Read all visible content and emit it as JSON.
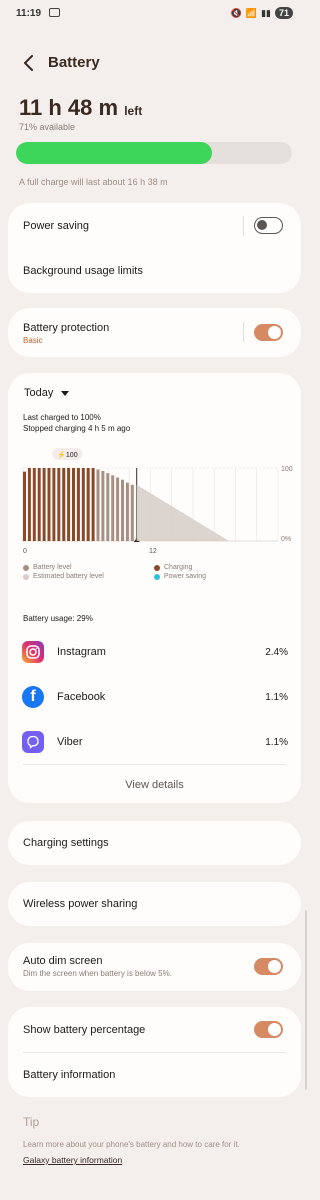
{
  "status": {
    "time": "11:19",
    "battery": "71"
  },
  "header": {
    "title": "Battery"
  },
  "summary": {
    "time_left": "11 h 48 m",
    "time_left_suffix": "left",
    "available": "71% available",
    "level_percent": 71,
    "full_charge_note": "A full charge will last about 16 h 38 m"
  },
  "card1": {
    "power_saving": "Power saving",
    "background_limits": "Background usage limits"
  },
  "card2": {
    "battery_protection": "Battery protection",
    "protection_mode": "Basic"
  },
  "usage": {
    "period": "Today",
    "last_charged": "Last charged to 100%",
    "stopped": "Stopped charging 4 h 5 m ago",
    "bubble": "100",
    "legend": {
      "battery_level": "Battery level",
      "estimated": "Estimated battery level",
      "charging": "Charging",
      "power_saving": "Power saving"
    },
    "battery_usage": "Battery usage: 29%",
    "view_details": "View details",
    "apps": [
      {
        "name": "Instagram",
        "percent": "2.4%",
        "icon": "instagram-icon"
      },
      {
        "name": "Facebook",
        "percent": "1.1%",
        "icon": "facebook-icon"
      },
      {
        "name": "Viber",
        "percent": "1.1%",
        "icon": "viber-icon"
      }
    ]
  },
  "chart_data": {
    "type": "bar",
    "x_ticks": [
      "0",
      "12"
    ],
    "y_ticks": [
      "100",
      "0%"
    ],
    "ylim": [
      0,
      100
    ],
    "series": [
      {
        "name": "Charging",
        "values": [
          95,
          100,
          100,
          100,
          100,
          100,
          100,
          100,
          100,
          100,
          100,
          100,
          100,
          100,
          100
        ]
      },
      {
        "name": "Battery level",
        "values": [
          98,
          96,
          93,
          90,
          87,
          84,
          80,
          77
        ]
      }
    ],
    "estimated_line": {
      "start": 77,
      "end": 0
    }
  },
  "settings": {
    "charging_settings": "Charging settings",
    "wireless_sharing": "Wireless power sharing",
    "auto_dim": "Auto dim screen",
    "auto_dim_sub": "Dim the screen when battery is below 5%.",
    "show_percentage": "Show battery percentage",
    "battery_information": "Battery information"
  },
  "tip": {
    "title": "Tip",
    "text": "Learn more about your phone's battery and how to care for it.",
    "link": "Galaxy battery information"
  },
  "colors": {
    "accent": "#d68a63",
    "progress": "#3ed65a",
    "charging": "#8a4a2a",
    "battery_level": "#a88f84",
    "estimated": "#d6ccc7",
    "power_saving": "#2ec4d6"
  }
}
